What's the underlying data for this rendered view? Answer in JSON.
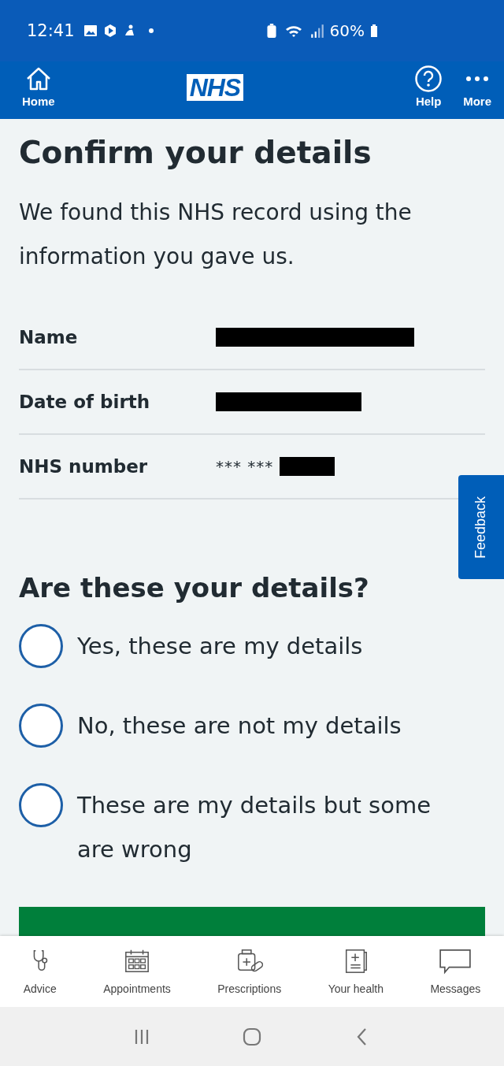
{
  "status_bar": {
    "time": "12:41",
    "battery": "60%"
  },
  "header": {
    "home": "Home",
    "logo": "NHS",
    "help": "Help",
    "more": "More"
  },
  "title": "Confirm your details",
  "intro": "We found this NHS record using the information you gave us.",
  "details": [
    {
      "label": "Name",
      "redacted": true
    },
    {
      "label": "Date of birth",
      "redacted": true
    },
    {
      "label": "NHS number",
      "value": "*** ***",
      "redacted": true
    }
  ],
  "feedback": "Feedback",
  "question": "Are these your details?",
  "options": [
    {
      "label": "Yes, these are my details",
      "selected": false
    },
    {
      "label": "No, these are not my details",
      "selected": false
    },
    {
      "label": "These are my details but some are wrong",
      "selected": false
    }
  ],
  "nav": [
    {
      "kind": "advice",
      "label": "Advice"
    },
    {
      "kind": "appointments",
      "label": "Appointments"
    },
    {
      "kind": "prescriptions",
      "label": "Prescriptions"
    },
    {
      "kind": "health",
      "label": "Your health"
    },
    {
      "kind": "messages",
      "label": "Messages"
    }
  ]
}
